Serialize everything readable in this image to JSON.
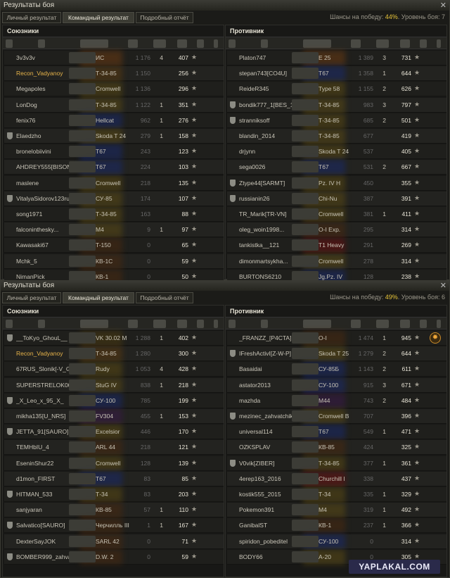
{
  "windows": [
    {
      "title": "Результаты боя",
      "tabs": [
        "Личный результат",
        "Командный результат",
        "Подробный отчёт"
      ],
      "active_tab": 1,
      "win_chance_label": "Шансы на победу: ",
      "win_chance": "44%",
      "battle_level_label": ". Уровень боя: ",
      "battle_level": "7",
      "allies_title": "Союзники",
      "enemies_title": "Противник",
      "allies": [
        {
          "player": "3v3v3v",
          "tank": "ИС",
          "damage": "1 176",
          "frags": "4",
          "xp": "407",
          "clan": false,
          "hl": false,
          "color": "#6a3a12"
        },
        {
          "player": "Recon_Vadyanoy",
          "tank": "Т-34-85",
          "damage": "1 150",
          "frags": "",
          "xp": "256",
          "clan": false,
          "hl": true,
          "color": "#5a3a10"
        },
        {
          "player": "Megapoles",
          "tank": "Cromwell",
          "damage": "1 136",
          "frags": "",
          "xp": "296",
          "clan": false,
          "hl": false,
          "color": "#5a4a14"
        },
        {
          "player": "LonDog",
          "tank": "Т-34-85",
          "damage": "1 122",
          "frags": "1",
          "xp": "351",
          "clan": false,
          "hl": false,
          "color": "#5a4a14"
        },
        {
          "player": "fenix76",
          "tank": "Hellcat",
          "damage": "962",
          "frags": "1",
          "xp": "276",
          "clan": false,
          "hl": false,
          "color": "#1a2a6a"
        },
        {
          "player": "Elaedzho",
          "tank": "Skoda T 24",
          "damage": "279",
          "frags": "1",
          "xp": "158",
          "clan": true,
          "hl": false,
          "color": "#5a4a14"
        },
        {
          "player": "bronelobiivini",
          "tank": "T67",
          "damage": "243",
          "frags": "",
          "xp": "123",
          "clan": false,
          "hl": false,
          "color": "#1a2a6a"
        },
        {
          "player": "AHDREY555[BISON]",
          "tank": "T67",
          "damage": "224",
          "frags": "",
          "xp": "103",
          "clan": false,
          "hl": false,
          "color": "#1a2a6a"
        },
        {
          "player": "maslene",
          "tank": "Cromwell",
          "damage": "218",
          "frags": "",
          "xp": "135",
          "clan": false,
          "hl": false,
          "color": "#5a4a14"
        },
        {
          "player": "VitalyaSidorov123rus",
          "tank": "СУ-85",
          "damage": "174",
          "frags": "",
          "xp": "107",
          "clan": true,
          "hl": false,
          "color": "#5a4a14"
        },
        {
          "player": "song1971",
          "tank": "Т-34-85",
          "damage": "163",
          "frags": "",
          "xp": "88",
          "clan": false,
          "hl": false,
          "color": "#5a4a14"
        },
        {
          "player": "falconinthesky...",
          "tank": "M4",
          "damage": "9",
          "frags": "1",
          "xp": "97",
          "clan": false,
          "hl": false,
          "color": "#5a4a14"
        },
        {
          "player": "Kawasaki67",
          "tank": "T-150",
          "damage": "0",
          "frags": "",
          "xp": "65",
          "clan": false,
          "hl": false,
          "color": "#4a2a10"
        },
        {
          "player": "Mchk_5",
          "tank": "КВ-1С",
          "damage": "0",
          "frags": "",
          "xp": "59",
          "clan": false,
          "hl": false,
          "color": "#4a2a10"
        },
        {
          "player": "NimanPick",
          "tank": "КВ-1",
          "damage": "0",
          "frags": "",
          "xp": "50",
          "clan": false,
          "hl": false,
          "color": "#4a2a10"
        }
      ],
      "enemies": [
        {
          "player": "Platon747",
          "tank": "E 25",
          "damage": "1 389",
          "frags": "3",
          "xp": "731",
          "clan": false,
          "hl": false,
          "color": "#6a3a12"
        },
        {
          "player": "stepan743[CO4U]",
          "tank": "T67",
          "damage": "1 358",
          "frags": "1",
          "xp": "644",
          "clan": false,
          "hl": false,
          "color": "#1a2a6a"
        },
        {
          "player": "ReideR345",
          "tank": "Type 58",
          "damage": "1 155",
          "frags": "2",
          "xp": "626",
          "clan": false,
          "hl": false,
          "color": "#5a4a14"
        },
        {
          "player": "bondik777_1[BES_1]",
          "tank": "Т-34-85",
          "damage": "983",
          "frags": "3",
          "xp": "797",
          "clan": true,
          "hl": false,
          "color": "#5a4a14"
        },
        {
          "player": "stranniksoff",
          "tank": "Т-34-85",
          "damage": "685",
          "frags": "2",
          "xp": "501",
          "clan": true,
          "hl": false,
          "color": "#5a4a14"
        },
        {
          "player": "blandin_2014",
          "tank": "Т-34-85",
          "damage": "677",
          "frags": "",
          "xp": "419",
          "clan": false,
          "hl": false,
          "color": "#5a4a14"
        },
        {
          "player": "drjynn",
          "tank": "Skoda T 24",
          "damage": "537",
          "frags": "",
          "xp": "405",
          "clan": false,
          "hl": false,
          "color": "#5a4a14"
        },
        {
          "player": "sega0026",
          "tank": "T67",
          "damage": "531",
          "frags": "2",
          "xp": "667",
          "clan": false,
          "hl": false,
          "color": "#1a2a6a"
        },
        {
          "player": "Ztype44[SARMT]",
          "tank": "Pz. IV H",
          "damage": "450",
          "frags": "",
          "xp": "355",
          "clan": true,
          "hl": false,
          "color": "#5a4a14"
        },
        {
          "player": "russianin26",
          "tank": "Chi-Nu",
          "damage": "387",
          "frags": "",
          "xp": "391",
          "clan": true,
          "hl": false,
          "color": "#5a4a14"
        },
        {
          "player": "TR_Marik[TR-VN]",
          "tank": "Cromwell",
          "damage": "381",
          "frags": "1",
          "xp": "411",
          "clan": false,
          "hl": false,
          "color": "#5a4a14"
        },
        {
          "player": "oleg_woin1998...",
          "tank": "O-I Exp.",
          "damage": "295",
          "frags": "",
          "xp": "314",
          "clan": false,
          "hl": false,
          "color": "#4a2a10"
        },
        {
          "player": "tankistka__121",
          "tank": "T1 Heavy",
          "damage": "291",
          "frags": "",
          "xp": "269",
          "clan": false,
          "hl": false,
          "color": "#6a1010"
        },
        {
          "player": "dimonmartsykha...",
          "tank": "Cromwell",
          "damage": "278",
          "frags": "",
          "xp": "314",
          "clan": false,
          "hl": false,
          "color": "#5a4a14"
        },
        {
          "player": "BURTONS6210",
          "tank": "Jg.Pz. IV",
          "damage": "128",
          "frags": "",
          "xp": "238",
          "clan": false,
          "hl": false,
          "color": "#1a2a6a"
        }
      ]
    },
    {
      "title": "Результаты боя",
      "tabs": [
        "Личный результат",
        "Командный результат",
        "Подробный отчёт"
      ],
      "active_tab": 1,
      "win_chance_label": "Шансы на победу: ",
      "win_chance": "49%",
      "battle_level_label": ". Уровень боя: ",
      "battle_level": "6",
      "allies_title": "Союзники",
      "enemies_title": "Противник",
      "allies": [
        {
          "player": "__ToKyo_GhouL__",
          "tank": "VK 30.02 M",
          "damage": "1 288",
          "frags": "1",
          "xp": "402",
          "clan": true,
          "hl": false,
          "color": "#4a3a10"
        },
        {
          "player": "Recon_Vadyanoy",
          "tank": "Т-34-85",
          "damage": "1 280",
          "frags": "",
          "xp": "300",
          "clan": false,
          "hl": true,
          "color": "#5a3a10"
        },
        {
          "player": "67RUS_Slonik[-V_G-]",
          "tank": "Rudy",
          "damage": "1 053",
          "frags": "4",
          "xp": "428",
          "clan": false,
          "hl": false,
          "color": "#5a4a14"
        },
        {
          "player": "SUPERSTRELOK001...",
          "tank": "StuG IV",
          "damage": "838",
          "frags": "1",
          "xp": "218",
          "clan": false,
          "hl": false,
          "color": "#5a4a14"
        },
        {
          "player": "_X_Leo_x_95_X_",
          "tank": "СУ-100",
          "damage": "785",
          "frags": "",
          "xp": "199",
          "clan": true,
          "hl": false,
          "color": "#1a2a6a"
        },
        {
          "player": "mikha135[U_NRS]",
          "tank": "FV304",
          "damage": "455",
          "frags": "1",
          "xp": "153",
          "clan": false,
          "hl": false,
          "color": "#3a1a4a"
        },
        {
          "player": "JETTA_91[SAURO]",
          "tank": "Excelsior",
          "damage": "446",
          "frags": "",
          "xp": "170",
          "clan": true,
          "hl": false,
          "color": "#5a4a14"
        },
        {
          "player": "TEMHbIU_4",
          "tank": "ARL 44",
          "damage": "218",
          "frags": "",
          "xp": "121",
          "clan": false,
          "hl": false,
          "color": "#4a2a10"
        },
        {
          "player": "EseninShur22",
          "tank": "Cromwell",
          "damage": "128",
          "frags": "",
          "xp": "139",
          "clan": false,
          "hl": false,
          "color": "#5a4a14"
        },
        {
          "player": "d1mon_FIRST",
          "tank": "T67",
          "damage": "83",
          "frags": "",
          "xp": "85",
          "clan": false,
          "hl": false,
          "color": "#1a2a6a"
        },
        {
          "player": "HITMAN_533",
          "tank": "Т-34",
          "damage": "83",
          "frags": "",
          "xp": "203",
          "clan": true,
          "hl": false,
          "color": "#5a4a14"
        },
        {
          "player": "sanjyaran",
          "tank": "КВ-85",
          "damage": "57",
          "frags": "1",
          "xp": "110",
          "clan": false,
          "hl": false,
          "color": "#4a2a10"
        },
        {
          "player": "Salvatico[SAURO]",
          "tank": "Черчилль III",
          "damage": "1",
          "frags": "1",
          "xp": "167",
          "clan": true,
          "hl": false,
          "color": "#4a2a10"
        },
        {
          "player": "DexterSayJOK",
          "tank": "SARL 42",
          "damage": "0",
          "frags": "",
          "xp": "71",
          "clan": false,
          "hl": false,
          "color": "#4a2a10"
        },
        {
          "player": "BOMBER999_zahvat...",
          "tank": "D.W. 2",
          "damage": "0",
          "frags": "",
          "xp": "59",
          "clan": true,
          "hl": false,
          "color": "#4a2a10"
        }
      ],
      "enemies": [
        {
          "player": "_FRANZZ_[P4CTA]",
          "tank": "O-I",
          "damage": "1 474",
          "frags": "1",
          "xp": "945",
          "clan": false,
          "hl": false,
          "color": "#4a2a10",
          "badge": true
        },
        {
          "player": "IFreshActivI[Z-W-P]",
          "tank": "Skoda T 25",
          "damage": "1 279",
          "frags": "2",
          "xp": "644",
          "clan": true,
          "hl": false,
          "color": "#5a4a14"
        },
        {
          "player": "Basaidai",
          "tank": "СУ-85Б",
          "damage": "1 143",
          "frags": "2",
          "xp": "611",
          "clan": false,
          "hl": false,
          "color": "#1a2a6a"
        },
        {
          "player": "astator2013",
          "tank": "СУ-100",
          "damage": "915",
          "frags": "3",
          "xp": "671",
          "clan": false,
          "hl": false,
          "color": "#1a2a6a"
        },
        {
          "player": "mazhda",
          "tank": "M44",
          "damage": "743",
          "frags": "2",
          "xp": "484",
          "clan": false,
          "hl": false,
          "color": "#3a1a4a"
        },
        {
          "player": "mezinec_zahvatchik",
          "tank": "Cromwell B",
          "damage": "707",
          "frags": "",
          "xp": "396",
          "clan": true,
          "hl": false,
          "color": "#5a4a14"
        },
        {
          "player": "universal114",
          "tank": "T67",
          "damage": "549",
          "frags": "1",
          "xp": "471",
          "clan": false,
          "hl": false,
          "color": "#1a2a6a"
        },
        {
          "player": "OZKSPLAV",
          "tank": "КВ-85",
          "damage": "424",
          "frags": "",
          "xp": "325",
          "clan": false,
          "hl": false,
          "color": "#4a2a10"
        },
        {
          "player": "V0vik[ZIBER]",
          "tank": "Т-34-85",
          "damage": "377",
          "frags": "1",
          "xp": "361",
          "clan": true,
          "hl": false,
          "color": "#5a4a14"
        },
        {
          "player": "4erep163_2016",
          "tank": "Churchill I",
          "damage": "338",
          "frags": "",
          "xp": "437",
          "clan": false,
          "hl": false,
          "color": "#6a1010"
        },
        {
          "player": "kostik555_2015",
          "tank": "Т-34",
          "damage": "335",
          "frags": "1",
          "xp": "329",
          "clan": false,
          "hl": false,
          "color": "#5a4a14"
        },
        {
          "player": "Pokemon391",
          "tank": "M4",
          "damage": "319",
          "frags": "1",
          "xp": "492",
          "clan": false,
          "hl": false,
          "color": "#5a4a14"
        },
        {
          "player": "GanibalST",
          "tank": "КВ-1",
          "damage": "237",
          "frags": "1",
          "xp": "366",
          "clan": false,
          "hl": false,
          "color": "#4a2a10"
        },
        {
          "player": "spiridon_pobeditel",
          "tank": "СУ-100",
          "damage": "0",
          "frags": "",
          "xp": "314",
          "clan": false,
          "hl": false,
          "color": "#1a2a6a"
        },
        {
          "player": "BODY66",
          "tank": "A-20",
          "damage": "0",
          "frags": "",
          "xp": "305",
          "clan": false,
          "hl": false,
          "color": "#5a4a14"
        }
      ]
    }
  ],
  "watermark": "YAPLAKAL.COM"
}
